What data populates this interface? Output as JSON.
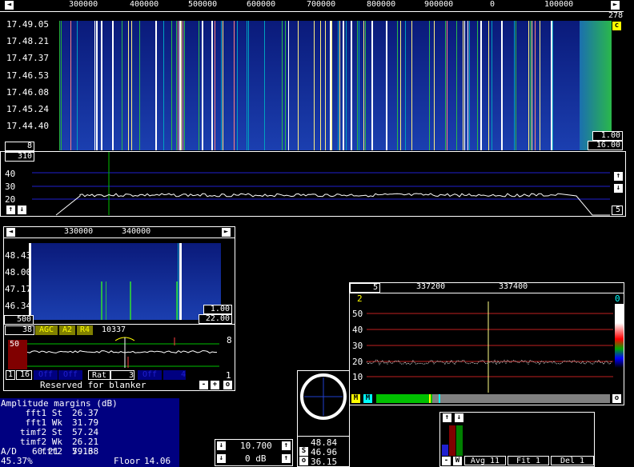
{
  "main_waterfall": {
    "freq_labels": [
      "300000",
      "400000",
      "500000",
      "600000",
      "700000",
      "800000",
      "900000",
      "0",
      "100000"
    ],
    "time_labels": [
      "17.49.05",
      "17.48.21",
      "17.47.37",
      "17.46.53",
      "17.46.08",
      "17.45.24",
      "17.44.40"
    ],
    "top_right_value": "278",
    "c_button": "c",
    "left_box": "8",
    "right_box_1": "1.00",
    "right_box_2": "16.00"
  },
  "main_spectrum": {
    "top_box": "310",
    "y_labels": [
      "40",
      "30",
      "20"
    ],
    "right_box": "5"
  },
  "sub_waterfall": {
    "freq_labels": [
      "330000",
      "340000"
    ],
    "time_labels": [
      "48.43",
      "48.00",
      "47.17",
      "46.34"
    ],
    "left_box": "500",
    "right_box_1": "1.00",
    "right_box_2": "22.00"
  },
  "sub_controls": {
    "bw": "38",
    "agc": "AGC",
    "a2": "A2",
    "r4": "R4",
    "freq": "10337",
    "level_box": "50",
    "right_num": "8",
    "bottom_1": "1",
    "bottom_16": "16",
    "off1": "Off",
    "off2": "Off",
    "rat_label": "Rat",
    "rat_value": "3",
    "off3": "Off",
    "four": "4",
    "right_one": "1",
    "reserved": "Reserved for blanker",
    "minus": "-",
    "plus": "+",
    "o": "o"
  },
  "baseband": {
    "top_box": "5",
    "freq_labels": [
      "337200",
      "337400"
    ],
    "y_labels": [
      "50",
      "40",
      "30",
      "20",
      "10"
    ],
    "corner_left": "2",
    "corner_right": "0",
    "m1": "M",
    "m2": "M",
    "o": "o"
  },
  "amplitude": {
    "title": "Amplitude margins (dB)",
    "rows": [
      {
        "label": "fft1 St",
        "value": "26.37"
      },
      {
        "label": "fft1 Wk",
        "value": "31.79"
      },
      {
        "label": "timf2 St",
        "value": "57.24"
      },
      {
        "label": "timf2 Wk",
        "value": "26.21"
      },
      {
        "label": "fft2",
        "value": "7.13"
      }
    ],
    "ad_label": "A/D",
    "ad_value1": "60.21",
    "ad_value2": "59.68",
    "percent": "45.37%",
    "floor_label": "Floor",
    "floor_value": "14.06"
  },
  "gain": {
    "freq_value": "10.700",
    "db_value": "0 dB"
  },
  "meter": {
    "values": [
      "48.84",
      "46.96",
      "36.15"
    ],
    "s_label": "S",
    "o_label": "o"
  },
  "agc_bar": {
    "w_label": "W",
    "avg_label": "Avg",
    "avg_value": "11",
    "fit_label": "Fit",
    "fit_value": "1",
    "del_label": "Del",
    "del_value": "1",
    "minus": "-"
  },
  "colors": {
    "waterfall_blue": "#1b3fb0",
    "green": "#00c000",
    "grid_blue": "#2020d0",
    "grid_red": "#c02020",
    "olive": "#808000",
    "dark_red": "#800000",
    "panel_blue": "#000080"
  }
}
